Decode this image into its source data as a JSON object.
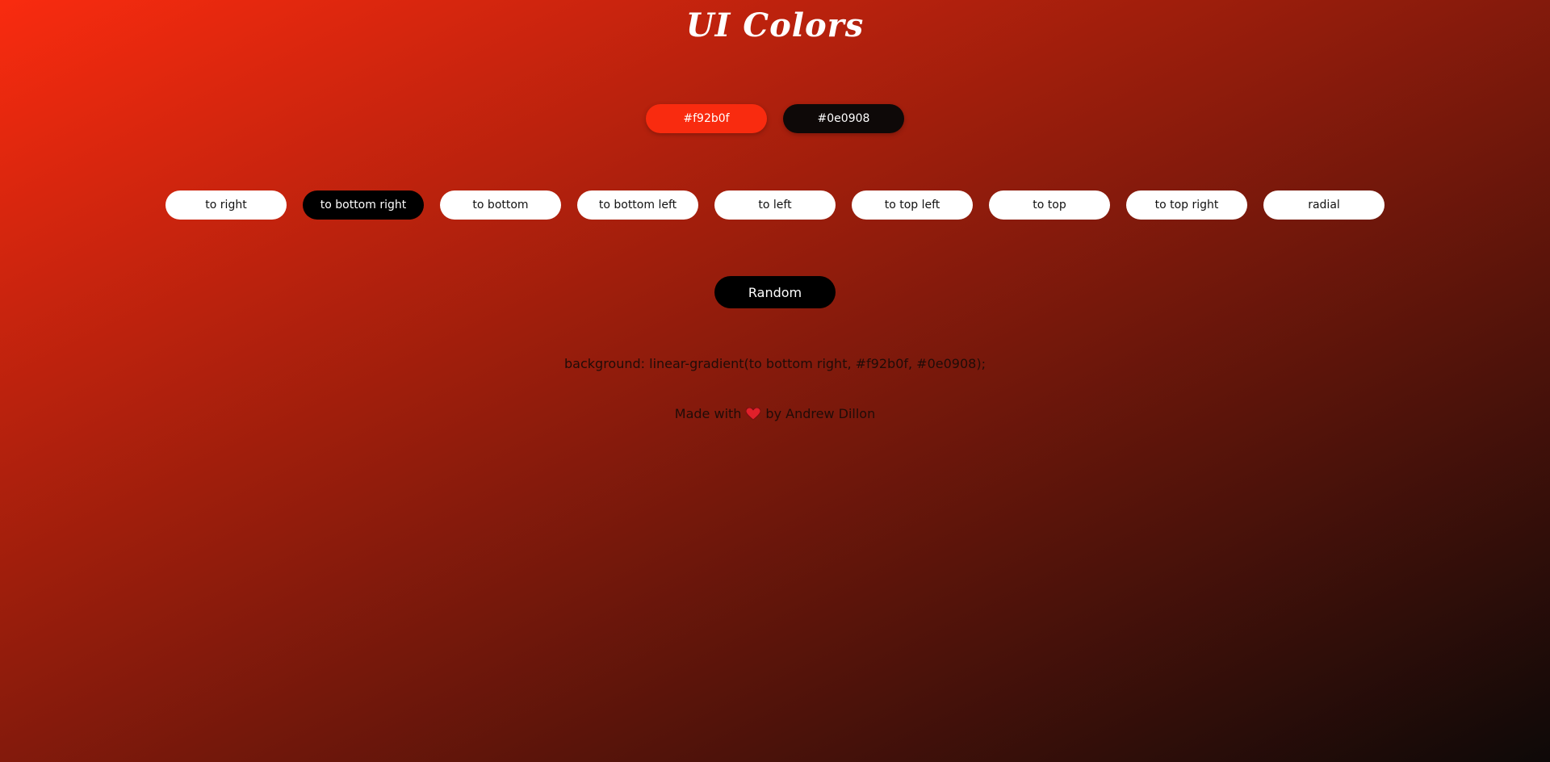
{
  "header": {
    "title": "UI Colors"
  },
  "colors": [
    {
      "label": "#f92b0f",
      "hex": "#f92b0f"
    },
    {
      "label": "#0e0908",
      "hex": "#0e0908"
    }
  ],
  "directions": [
    {
      "label": "to right",
      "active": false
    },
    {
      "label": "to bottom right",
      "active": true
    },
    {
      "label": "to bottom",
      "active": false
    },
    {
      "label": "to bottom left",
      "active": false
    },
    {
      "label": "to left",
      "active": false
    },
    {
      "label": "to top left",
      "active": false
    },
    {
      "label": "to top",
      "active": false
    },
    {
      "label": "to top right",
      "active": false
    },
    {
      "label": "radial",
      "active": false
    }
  ],
  "random": {
    "label": "Random"
  },
  "output": {
    "css": "background: linear-gradient(to bottom right, #f92b0f, #0e0908);"
  },
  "footer": {
    "prefix": "Made with",
    "heart_icon": "heart-icon",
    "suffix": "by Andrew Dillon",
    "heart_color": "#e0202a"
  }
}
